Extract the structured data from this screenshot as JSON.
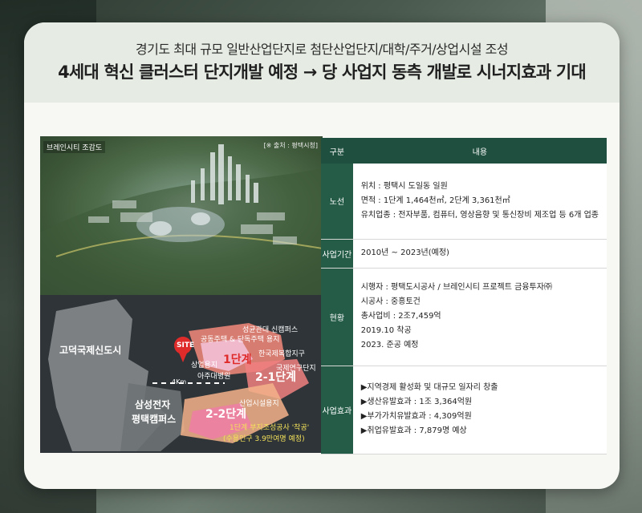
{
  "header": {
    "subtitle": "경기도 최대 규모 일반산업단지로 첨단산업단지/대학/주거/상업시설 조성",
    "title": "4세대 혁신 클러스터 단지개발 예정 → 당 사업지 동측 개발로 시너지효과 기대"
  },
  "maps": {
    "aerial_label": "브레인시티 조감도",
    "aerial_source": "[※ 출처 : 평택시청]",
    "zones": {
      "site": "SITE",
      "godeok": "고덕국제신도시",
      "samsung_line1": "삼성전자",
      "samsung_line2": "평택캠퍼스",
      "campus": "성균관대 신캠퍼스",
      "housing": "공동주택 & 단독주택 용지",
      "commercial": "상업용지",
      "hospital": "아주대병원",
      "intl_complex": "한국제복합지구",
      "research": "국제연구단지",
      "industrial": "산업시설용지",
      "phase1": "1단계",
      "phase2_1": "2-1단계",
      "phase2_2": "2-2단계",
      "distance": "4Km",
      "note_line1": "1단계 부지조성공사 '착공'",
      "note_line2": "(수용인구 3.9만여명 예정)"
    }
  },
  "table": {
    "col1": "구분",
    "col2": "내용",
    "rows": [
      {
        "label": "노선",
        "lines": [
          "위치 : 평택시 도일동 일원",
          "면적 : 1단계 1,464천㎡, 2단계 3,361천㎡",
          "유치업종 : 전자부품, 컴퓨터, 영상음향 및 통신장비 제조업 등  6개 업종"
        ]
      },
      {
        "label": "사업기간",
        "lines": [
          "2010년 ~ 2023년(예정)"
        ]
      },
      {
        "label": "현황",
        "lines": [
          "시행자 : 평택도시공사 / 브레인시티 프로젝트 금융투자㈜",
          "시공사 : 중흥토건",
          "총사업비 : 2조7,459억",
          "2019.10 착공",
          "2023. 준공 예정"
        ]
      },
      {
        "label": "사업효과",
        "lines": [
          "▶지역경제 활성화 및 대규모 일자리 창출",
          "▶생산유발효과 : 1조 3,364억원",
          "▶부가가치유발효과 : 4,309억원",
          "▶취업유발효과 : 7,879명 예상"
        ]
      }
    ]
  }
}
